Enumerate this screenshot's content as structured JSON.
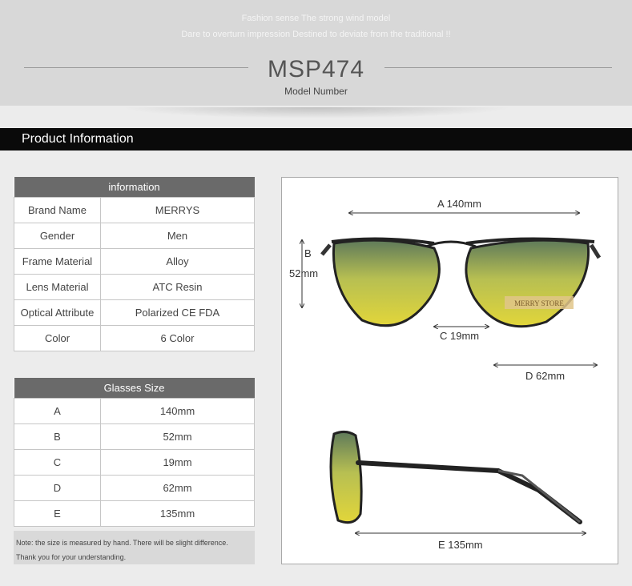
{
  "header": {
    "tagline1": "Fashion sense The strong wind model",
    "tagline2": "Dare to overturn impression Destined to deviate from the traditional !!",
    "model_number": "MSP474",
    "model_label": "Model Number"
  },
  "section": {
    "title": "Product Information"
  },
  "info_table": {
    "header": "information",
    "rows": [
      {
        "key": "Brand Name",
        "value": "MERRYS"
      },
      {
        "key": "Gender",
        "value": "Men"
      },
      {
        "key": "Frame Material",
        "value": "Alloy"
      },
      {
        "key": "Lens Material",
        "value": "ATC Resin"
      },
      {
        "key": "Optical Attribute",
        "value": "Polarized CE FDA"
      },
      {
        "key": "Color",
        "value": "6 Color"
      }
    ]
  },
  "size_table": {
    "header": "Glasses Size",
    "rows": [
      {
        "key": "A",
        "value": "140mm"
      },
      {
        "key": "B",
        "value": "52mm"
      },
      {
        "key": "C",
        "value": "19mm"
      },
      {
        "key": "D",
        "value": "62mm"
      },
      {
        "key": "E",
        "value": "135mm"
      }
    ]
  },
  "note": {
    "line1": "Note: the size is measured by hand. There will be slight difference.",
    "line2": "Thank you for your understanding."
  },
  "diagram": {
    "a_label": "A 140mm",
    "b_letter": "B",
    "b_value": "52mm",
    "c_label": "C 19mm",
    "d_label": "D 62mm",
    "e_label": "E 135mm",
    "watermark": "MERRY STORE"
  },
  "colors": {
    "banner_bg": "#d8d8d8",
    "section_bar": "#0a0a0a",
    "table_header": "#6a6a6a",
    "lens_top": "#5f7a5a",
    "lens_bottom": "#e2d63a"
  }
}
